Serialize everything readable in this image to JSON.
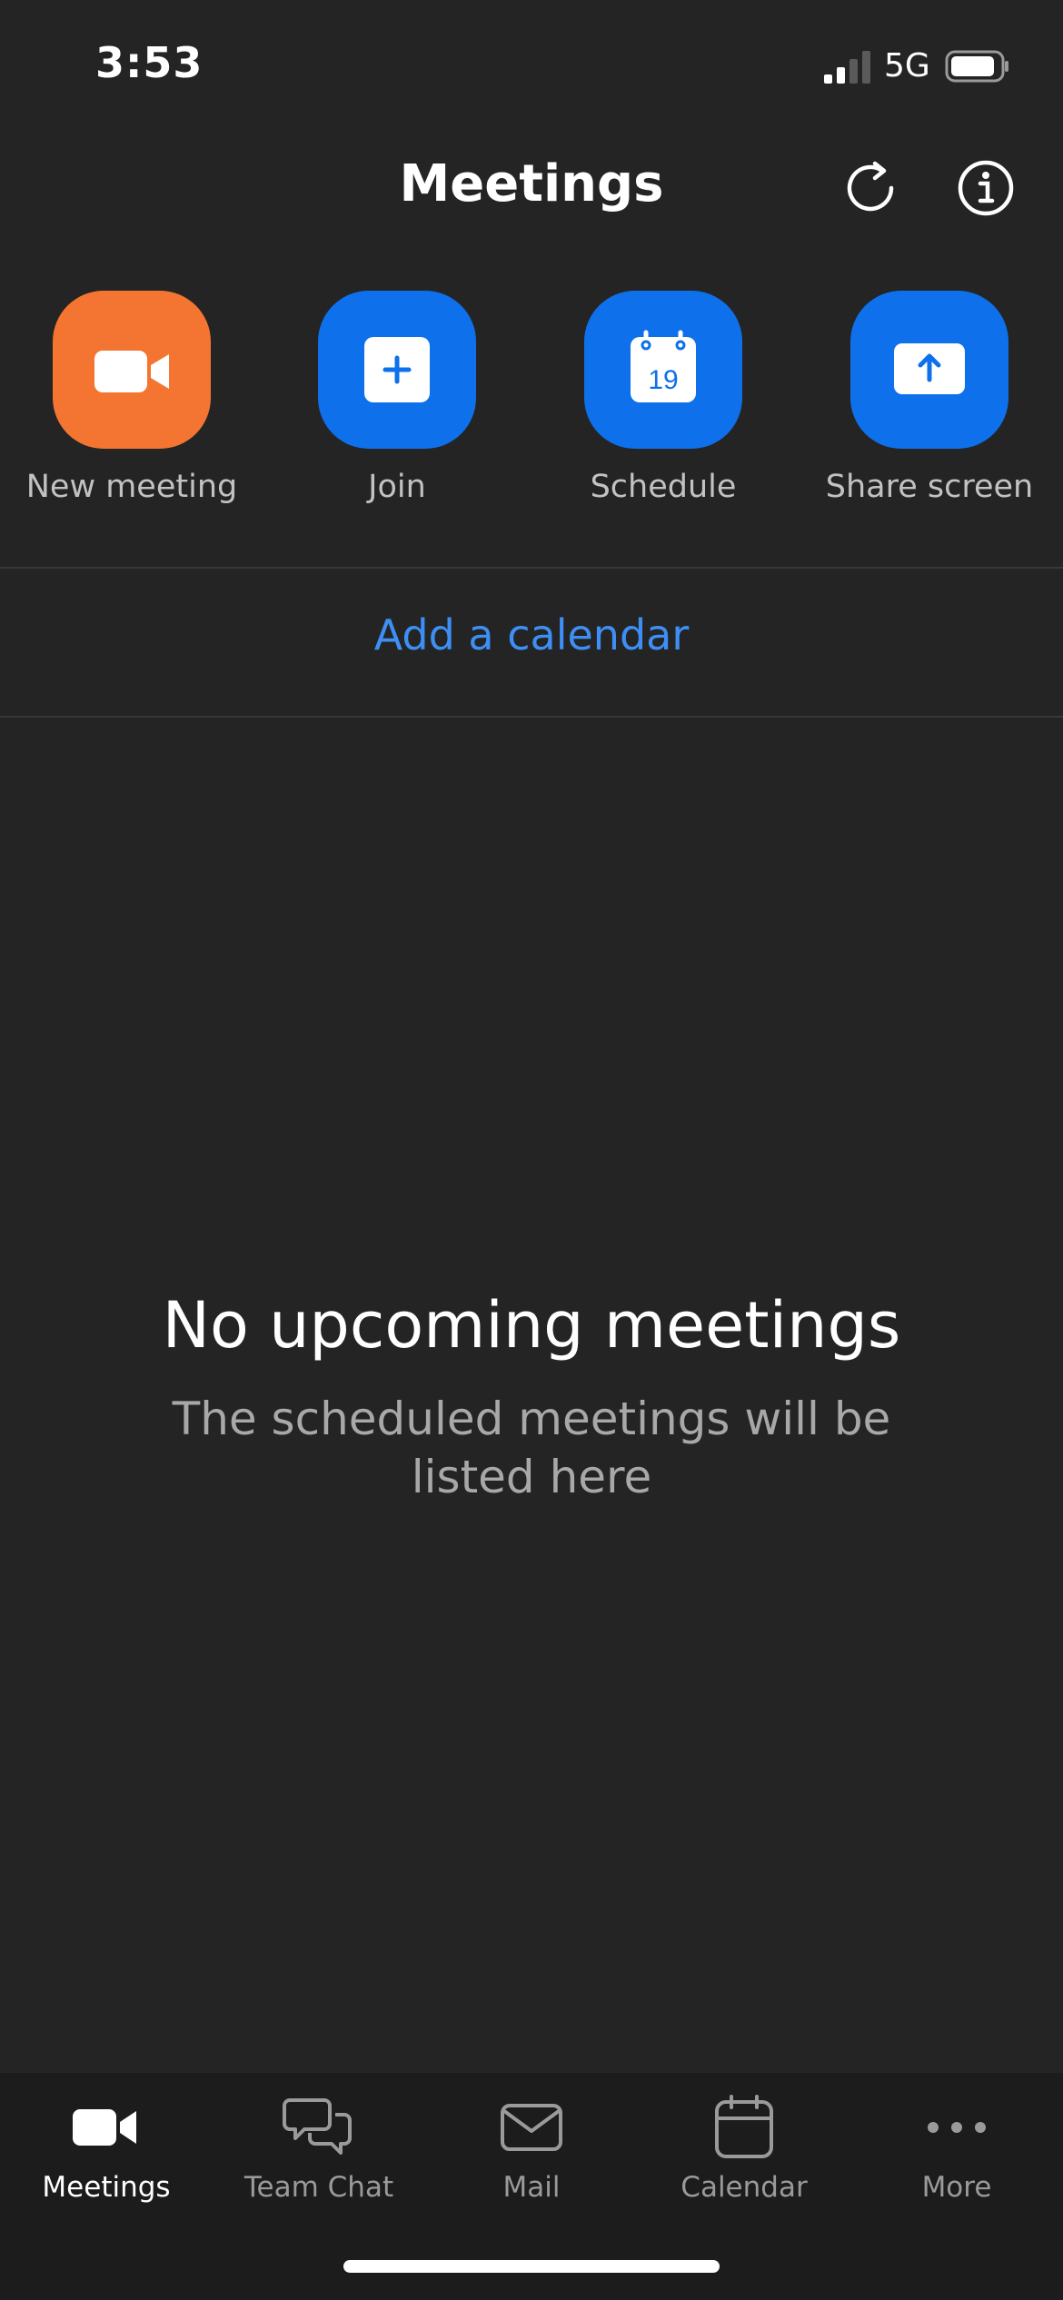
{
  "status_bar": {
    "time": "3:53",
    "network": "5G"
  },
  "header": {
    "title": "Meetings",
    "refresh_icon": "refresh-icon",
    "info_icon": "info-icon"
  },
  "actions": [
    {
      "label": "New meeting",
      "icon": "video-camera-icon",
      "color": "#f47531"
    },
    {
      "label": "Join",
      "icon": "plus-icon",
      "color": "#0e71eb"
    },
    {
      "label": "Schedule",
      "icon": "calendar-icon",
      "color": "#0e71eb",
      "calendar_day": "19"
    },
    {
      "label": "Share screen",
      "icon": "upload-arrow-icon",
      "color": "#0e71eb"
    }
  ],
  "calendar_link": {
    "label": "Add a calendar",
    "color": "#3d8ff5"
  },
  "empty_state": {
    "title": "No upcoming meetings",
    "subtitle": "The scheduled meetings will be listed here"
  },
  "tab_bar": {
    "active": "Meetings",
    "tabs": [
      {
        "label": "Meetings",
        "icon": "video-camera-icon"
      },
      {
        "label": "Team Chat",
        "icon": "chat-bubbles-icon"
      },
      {
        "label": "Mail",
        "icon": "envelope-icon"
      },
      {
        "label": "Calendar",
        "icon": "calendar-icon"
      },
      {
        "label": "More",
        "icon": "more-dots-icon"
      }
    ]
  }
}
